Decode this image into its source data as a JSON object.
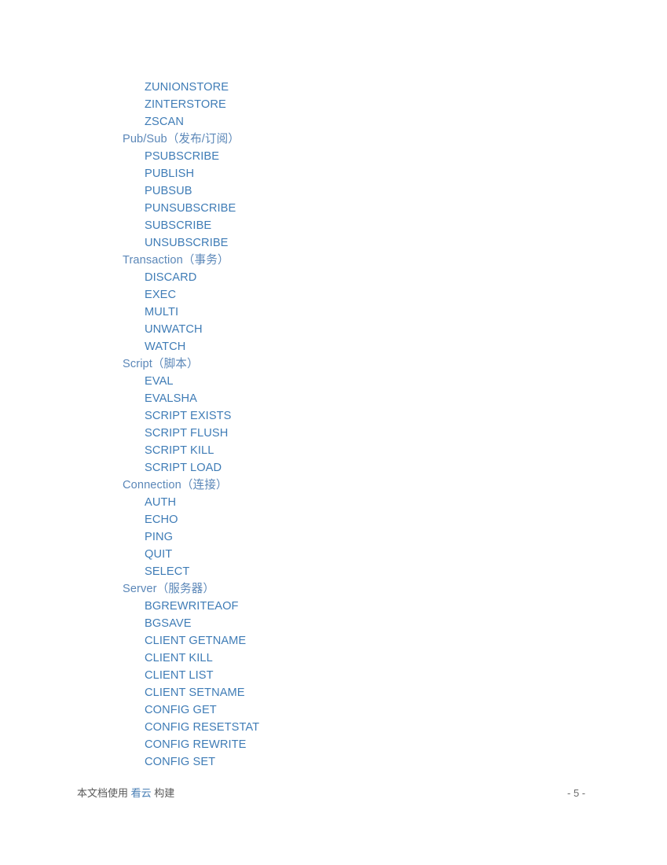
{
  "document": {
    "page_number_label": "- 5 -",
    "colors": {
      "command_blue": "#3f7cb6",
      "category_blue": "#5b87b8",
      "brand_blue": "#4a7fb5",
      "footer_gray": "#595959",
      "page_background": "#ffffff"
    }
  },
  "toc": {
    "entries": [
      {
        "level": "command",
        "text": "ZUNIONSTORE"
      },
      {
        "level": "command",
        "text": "ZINTERSTORE"
      },
      {
        "level": "command",
        "text": "ZSCAN"
      },
      {
        "level": "category",
        "text": "Pub/Sub（发布/订阅）"
      },
      {
        "level": "command",
        "text": "PSUBSCRIBE"
      },
      {
        "level": "command",
        "text": "PUBLISH"
      },
      {
        "level": "command",
        "text": "PUBSUB"
      },
      {
        "level": "command",
        "text": "PUNSUBSCRIBE"
      },
      {
        "level": "command",
        "text": "SUBSCRIBE"
      },
      {
        "level": "command",
        "text": "UNSUBSCRIBE"
      },
      {
        "level": "category",
        "text": "Transaction（事务）"
      },
      {
        "level": "command",
        "text": "DISCARD"
      },
      {
        "level": "command",
        "text": "EXEC"
      },
      {
        "level": "command",
        "text": "MULTI"
      },
      {
        "level": "command",
        "text": "UNWATCH"
      },
      {
        "level": "command",
        "text": "WATCH"
      },
      {
        "level": "category",
        "text": "Script（脚本）"
      },
      {
        "level": "command",
        "text": "EVAL"
      },
      {
        "level": "command",
        "text": "EVALSHA"
      },
      {
        "level": "command",
        "text": "SCRIPT EXISTS"
      },
      {
        "level": "command",
        "text": "SCRIPT FLUSH"
      },
      {
        "level": "command",
        "text": "SCRIPT KILL"
      },
      {
        "level": "command",
        "text": "SCRIPT LOAD"
      },
      {
        "level": "category",
        "text": "Connection（连接）"
      },
      {
        "level": "command",
        "text": "AUTH"
      },
      {
        "level": "command",
        "text": "ECHO"
      },
      {
        "level": "command",
        "text": "PING"
      },
      {
        "level": "command",
        "text": "QUIT"
      },
      {
        "level": "command",
        "text": "SELECT"
      },
      {
        "level": "category",
        "text": "Server（服务器）"
      },
      {
        "level": "command",
        "text": "BGREWRITEAOF"
      },
      {
        "level": "command",
        "text": "BGSAVE"
      },
      {
        "level": "command",
        "text": "CLIENT GETNAME"
      },
      {
        "level": "command",
        "text": "CLIENT KILL"
      },
      {
        "level": "command",
        "text": "CLIENT LIST"
      },
      {
        "level": "command",
        "text": "CLIENT SETNAME"
      },
      {
        "level": "command",
        "text": "CONFIG GET"
      },
      {
        "level": "command",
        "text": "CONFIG RESETSTAT"
      },
      {
        "level": "command",
        "text": "CONFIG REWRITE"
      },
      {
        "level": "command",
        "text": "CONFIG SET"
      }
    ]
  },
  "footer": {
    "prefix_text": "本文档使用 ",
    "brand_text": "看云",
    "suffix_text": " 构建",
    "page_label": "- 5 -"
  }
}
